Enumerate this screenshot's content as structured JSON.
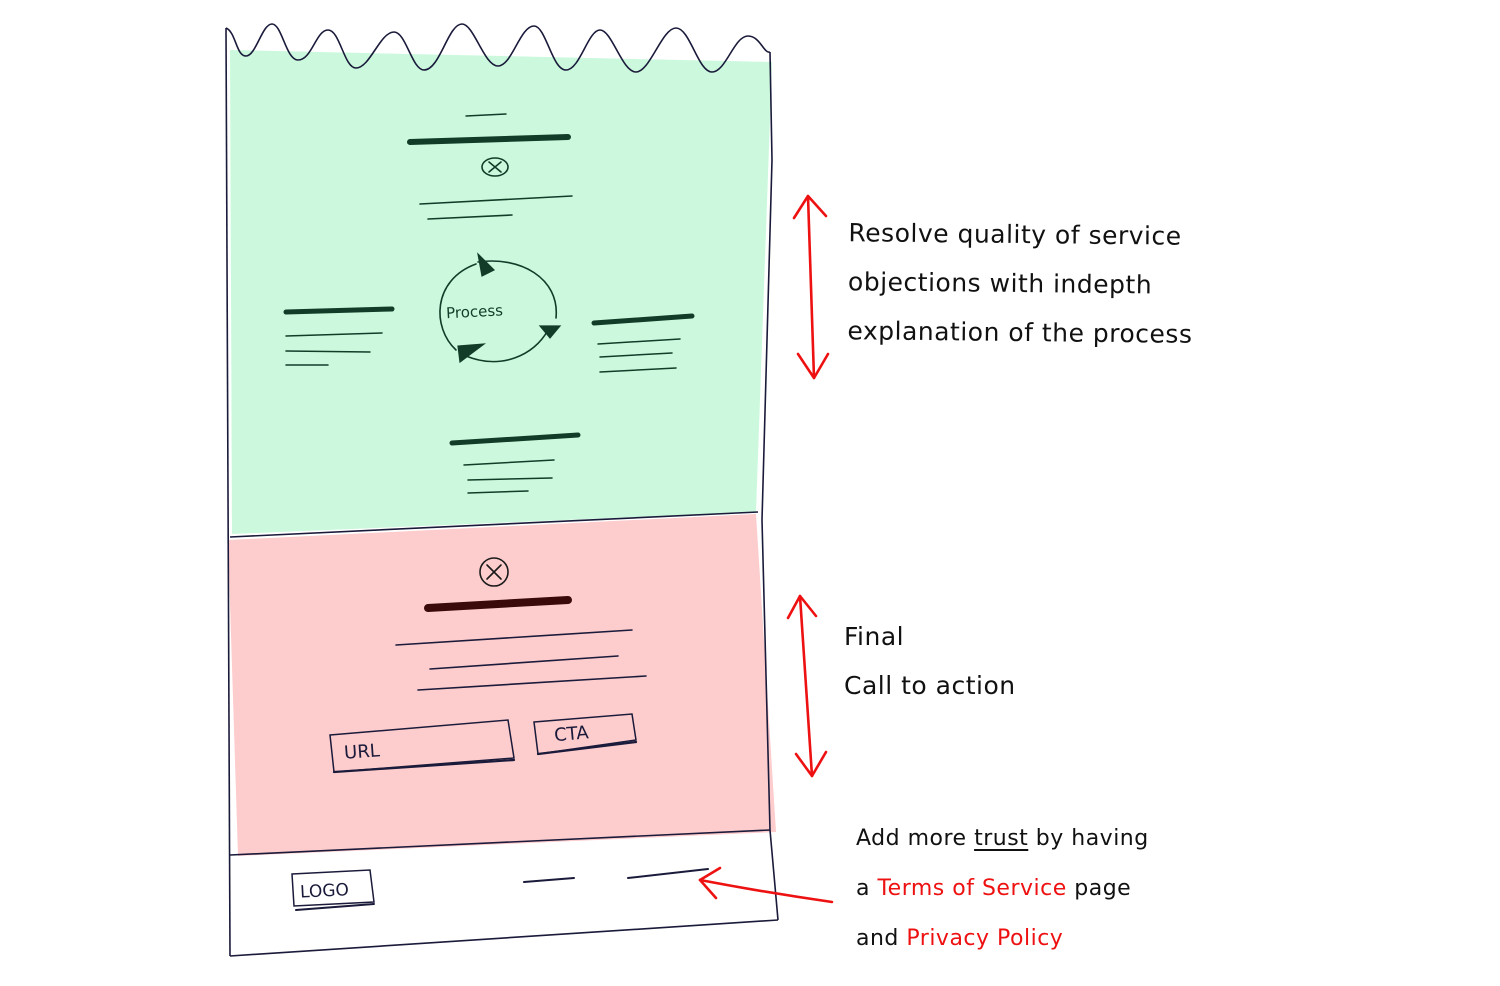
{
  "wireframe": {
    "process_section": {
      "diagram_label": "Process",
      "fill": "#ccf9de",
      "stroke": "#123c28"
    },
    "cta_section": {
      "url_field_label": "URL",
      "cta_button_label": "CTA",
      "fill": "#fdcccd",
      "stroke": "#3a0a0a"
    },
    "footer": {
      "logo_label": "LOGO"
    }
  },
  "annotations": {
    "process": {
      "lines": [
        "Resolve quality of service",
        "objections with indepth",
        "explanation of the process"
      ]
    },
    "cta": {
      "lines": [
        "Final",
        "Call to action"
      ]
    },
    "footer": {
      "line1_before": "Add more ",
      "line1_underlined": "trust",
      "line1_after": " by having",
      "line2_before": "a ",
      "line2_link": "Terms of Service",
      "line2_after": " page",
      "line3_before": "and ",
      "line3_link": "Privacy Policy"
    }
  },
  "colors": {
    "arrow": "#ee1111",
    "outline": "#1a1a3a"
  }
}
